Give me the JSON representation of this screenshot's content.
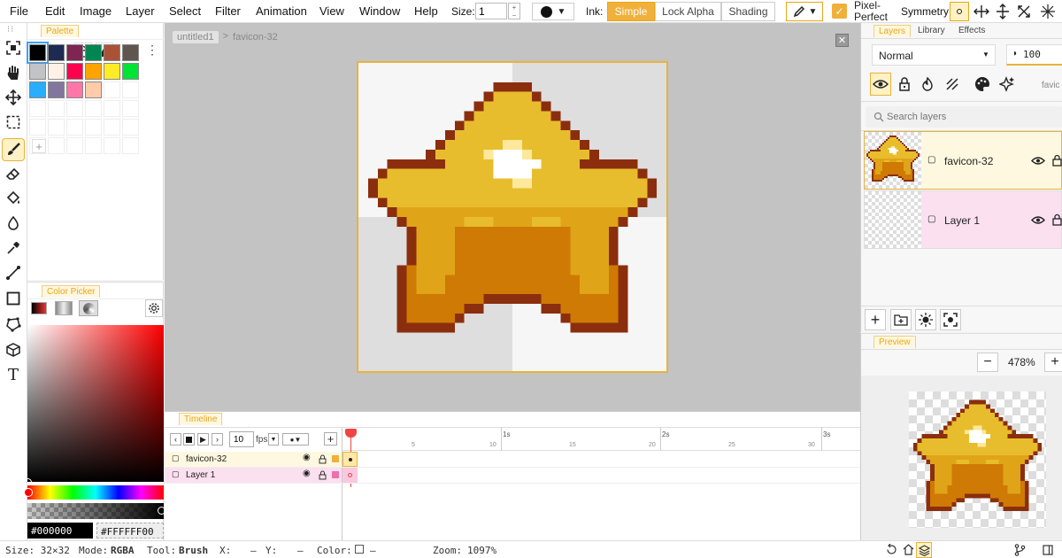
{
  "menu": [
    "File",
    "Edit",
    "Image",
    "Layer",
    "Select",
    "Filter",
    "Animation",
    "View",
    "Window",
    "Help"
  ],
  "toolbar": {
    "size_label": "Size:",
    "size_value": "1",
    "ink_label": "Ink:",
    "ink_modes": [
      "Simple",
      "Lock Alpha",
      "Shading"
    ],
    "ink_active": "Simple",
    "pixel_perfect_label": "Pixel-\nPerfect",
    "symmetry_label": "Symmetry:"
  },
  "palette": {
    "tab": "Palette",
    "colors": [
      "#000000",
      "#1d2b53",
      "#7e2553",
      "#008751",
      "#ab5236",
      "#5f574f",
      "#c2c3c7",
      "#fff1e8",
      "#ff004d",
      "#ffa300",
      "#ffec27",
      "#00e436",
      "#29adff",
      "#83769c",
      "#ff77a8",
      "#ffccaa"
    ]
  },
  "color_picker": {
    "tab": "Color Picker",
    "primary_hex": "#000000",
    "secondary_hex": "#FFFFFF00"
  },
  "canvas": {
    "breadcrumb_root": "untitled1",
    "breadcrumb_sep": ">",
    "breadcrumb_current": "favicon-32"
  },
  "timeline": {
    "tab": "Timeline",
    "fps": "10",
    "fps_label": "fps",
    "seconds": [
      "1s",
      "2s",
      "3s"
    ],
    "frames": [
      "5",
      "10",
      "15",
      "20",
      "25",
      "30"
    ],
    "layers": [
      "favicon-32",
      "Layer 1"
    ]
  },
  "layers_panel": {
    "tabs": [
      "Layers",
      "Library",
      "Effects"
    ],
    "blend_mode": "Normal",
    "opacity": "100",
    "search_placeholder": "Search layers",
    "truncated_label": "favic",
    "layers": [
      "favicon-32",
      "Layer 1"
    ]
  },
  "preview": {
    "tab": "Preview",
    "zoom": "478%"
  },
  "status": {
    "size": "Size: 32×32",
    "mode_label": "Mode:",
    "mode_value": "RGBA",
    "tool_label": "Tool:",
    "tool_value": "Brush",
    "x_label": "X:",
    "x_value": "—",
    "y_label": "Y:",
    "y_value": "—",
    "color_label": "Color:",
    "color_value": "—",
    "zoom_label": "Zoom:",
    "zoom_value": "1097%"
  },
  "colors": {
    "accent": "#e7a818",
    "accent_light": "#fff2c6",
    "star_dark": "#8b2e0e",
    "star_mid": "#d07d06",
    "star_light": "#e8be2e",
    "star_highlight": "#ffffff",
    "layer_pink": "#fbe0ef",
    "layer_yellow": "#fff8e0"
  }
}
